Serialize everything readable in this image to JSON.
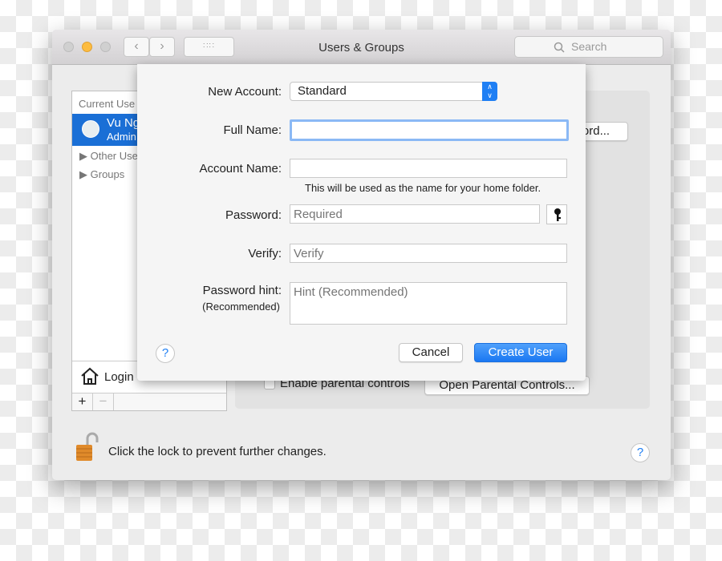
{
  "window": {
    "title": "Users & Groups",
    "search_placeholder": "Search"
  },
  "sidebar": {
    "section_current": "Current Use",
    "user_name": "Vu Ng",
    "user_role": "Admin",
    "other_users": "Other Use",
    "groups": "Groups",
    "login": "Login",
    "add": "+",
    "remove": "−"
  },
  "panel": {
    "password_button": "ord...",
    "enable_parental": "Enable parental controls",
    "open_parental": "Open Parental Controls..."
  },
  "footer": {
    "lock_text": "Click the lock to prevent further changes.",
    "help": "?"
  },
  "sheet": {
    "new_account_label": "New Account:",
    "new_account_value": "Standard",
    "full_name_label": "Full Name:",
    "full_name_value": "",
    "account_name_label": "Account Name:",
    "account_name_value": "",
    "account_hint": "This will be used as the name for your home folder.",
    "password_label": "Password:",
    "password_placeholder": "Required",
    "verify_label": "Verify:",
    "verify_placeholder": "Verify",
    "hint_label": "Password hint:",
    "hint_sub": "(Recommended)",
    "hint_placeholder": "Hint (Recommended)",
    "help": "?",
    "cancel": "Cancel",
    "create": "Create User"
  },
  "colors": {
    "accent": "#1f7ff4",
    "selection": "#1a6fd6"
  }
}
